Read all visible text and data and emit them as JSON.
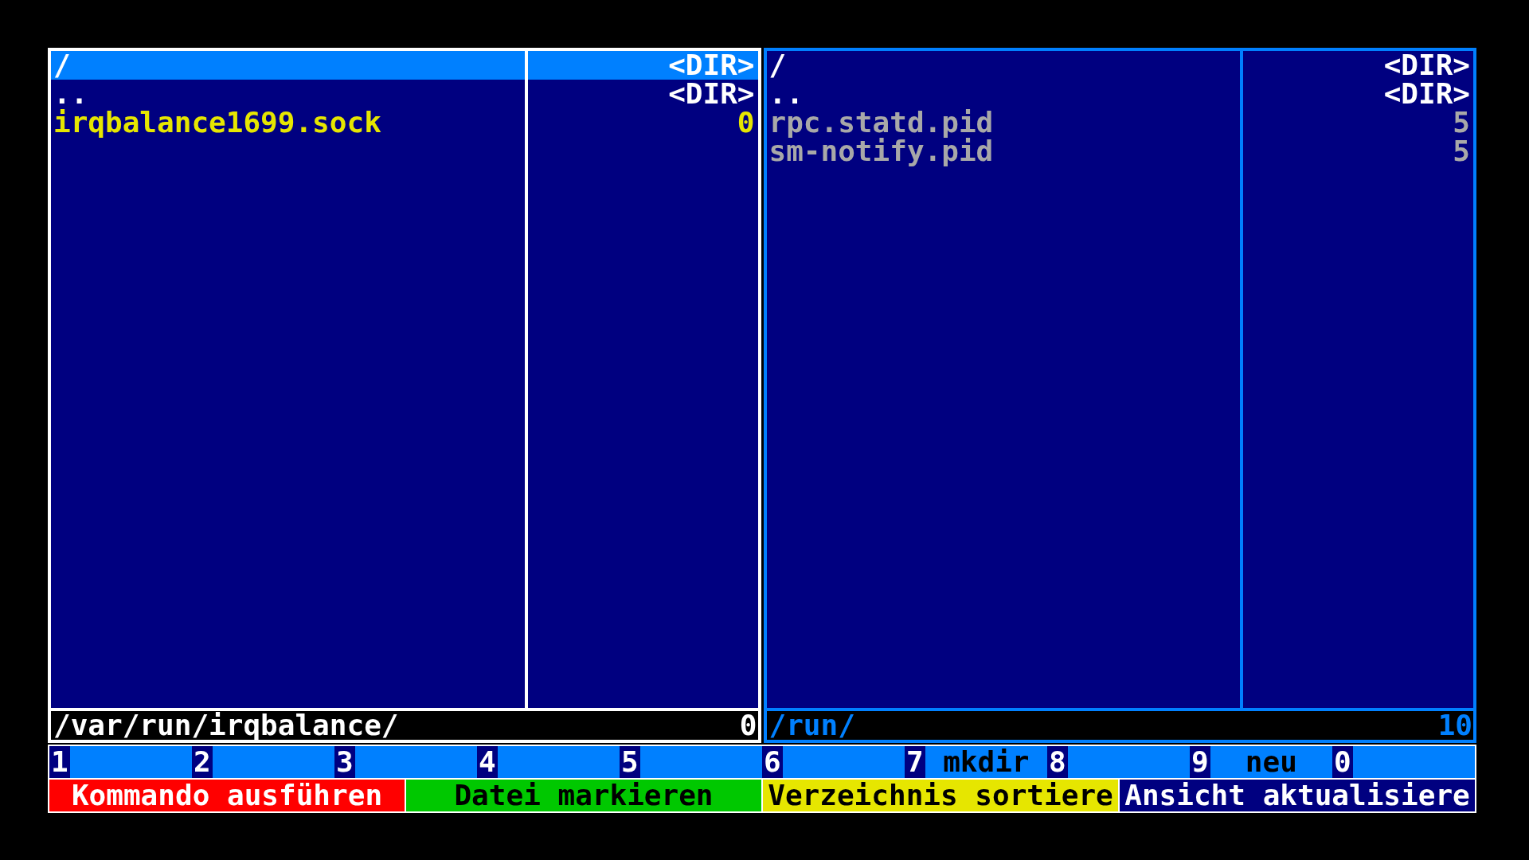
{
  "panels": [
    {
      "focused": true,
      "rows": [
        {
          "name": "/",
          "size": "<DIR>",
          "kind": "dir",
          "selected": true
        },
        {
          "name": "..",
          "size": "<DIR>",
          "kind": "dir",
          "selected": false
        },
        {
          "name": "irqbalance1699.sock",
          "size": "0",
          "kind": "socket",
          "selected": false
        }
      ],
      "path": "/var/run/irqbalance/",
      "count": "0"
    },
    {
      "focused": false,
      "rows": [
        {
          "name": "/",
          "size": "<DIR>",
          "kind": "dir",
          "selected": false
        },
        {
          "name": "..",
          "size": "<DIR>",
          "kind": "dir",
          "selected": false
        },
        {
          "name": "rpc.statd.pid",
          "size": "5",
          "kind": "file",
          "selected": false
        },
        {
          "name": "sm-notify.pid",
          "size": "5",
          "kind": "file",
          "selected": false
        }
      ],
      "path": "/run/",
      "count": "10"
    }
  ],
  "function_keys": [
    {
      "key": "1"
    },
    {
      "key": "2"
    },
    {
      "key": "3"
    },
    {
      "key": "4"
    },
    {
      "key": "5"
    },
    {
      "key": "6"
    },
    {
      "key": "7",
      "label": "mkdir"
    },
    {
      "key": "8"
    },
    {
      "key": "9",
      "label": "neu"
    },
    {
      "key": "0"
    }
  ],
  "actions": [
    {
      "label": "Kommando ausführen",
      "color": "#ff0000"
    },
    {
      "label": "Datei markieren",
      "color": "#00c800"
    },
    {
      "label": "Verzeichnis sortiere",
      "color": "#e6e600"
    },
    {
      "label": "Ansicht aktualisiere",
      "color": "#000080"
    }
  ]
}
